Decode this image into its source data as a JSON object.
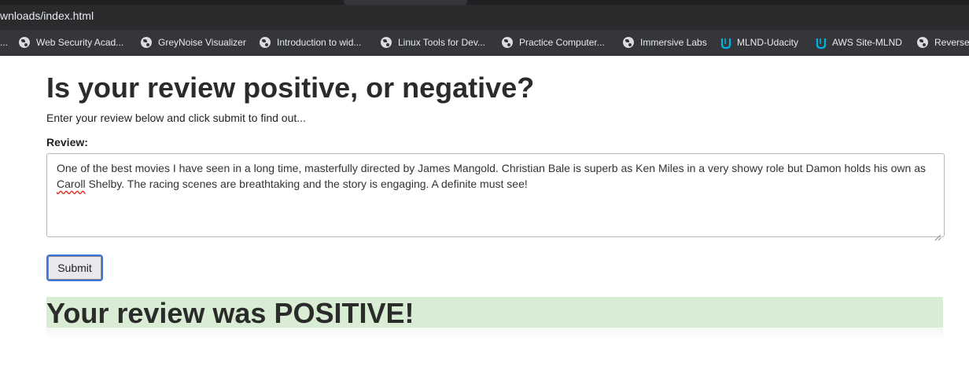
{
  "browser": {
    "url_text": "wnloads/index.html",
    "bookmarks": [
      {
        "label": "Web Security Acad...",
        "icon": "globe-icon"
      },
      {
        "label": "GreyNoise Visualizer",
        "icon": "globe-icon"
      },
      {
        "label": "Introduction to wid...",
        "icon": "globe-icon"
      },
      {
        "label": "Linux Tools for Dev...",
        "icon": "globe-icon"
      },
      {
        "label": "Practice Computer...",
        "icon": "globe-icon"
      },
      {
        "label": "Immersive Labs",
        "icon": "globe-icon"
      },
      {
        "label": "MLND-Udacity",
        "icon": "udacity-icon"
      },
      {
        "label": "AWS Site-MLND",
        "icon": "udacity-icon"
      },
      {
        "label": "Reverse",
        "icon": "globe-icon"
      }
    ],
    "leading_text": "...",
    "colors": {
      "chrome_dark": "#2a2b2d",
      "bookmarks_bg": "#35363a",
      "udacity_blue": "#02b3e4"
    }
  },
  "page": {
    "title": "Is your review positive, or negative?",
    "subtitle": "Enter your review below and click submit to find out...",
    "review_label": "Review:",
    "review_text_before": "One of the best movies I have seen in a long time, masterfully directed by James Mangold. Christian Bale is superb as Ken Miles in a very showy role but Damon holds his own as ",
    "review_misspelled": "Caroll",
    "review_text_after": " Shelby. The racing scenes are breathtaking and the story is engaging. A definite must see!",
    "submit_label": "Submit",
    "result_text": "Your review was POSITIVE!",
    "colors": {
      "result_bg": "#d9ecd4",
      "focus_ring": "#3a74d8",
      "heading": "#2b2b2b"
    }
  }
}
